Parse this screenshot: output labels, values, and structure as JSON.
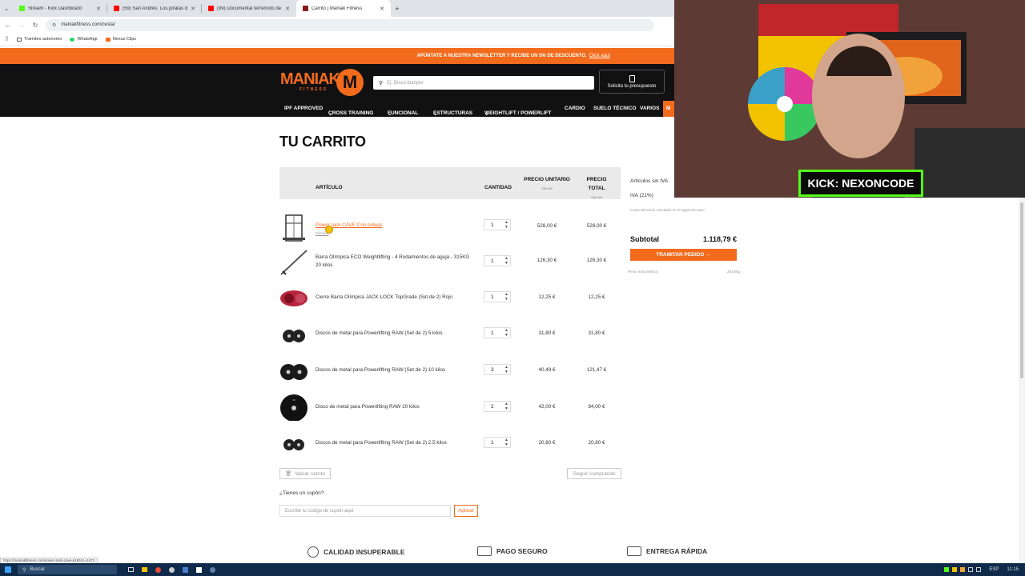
{
  "browser": {
    "tabs": [
      {
        "title": "Stream - Kick Dashboard",
        "color": "#53fc18"
      },
      {
        "title": "(59) San Andrés: Los piratas de",
        "color": "#ff0000"
      },
      {
        "title": "(99) Documental terremoto de",
        "color": "#ff0000"
      },
      {
        "title": "Carrito | Maniak Fitness",
        "color": "#8b1a1a"
      }
    ],
    "url": "maniakfitness.com/cesta/",
    "bookmarks": [
      "Tramites autonomo",
      "WhatsApp",
      "Nexus Clips"
    ]
  },
  "promo": {
    "text": "APÚNTATE A NUESTRA NEWSLETTER Y RECIBE UN 5% DE DESCUENTO.",
    "link": "Click aquí"
  },
  "header": {
    "logo_word": "MANIAK",
    "logo_sub": "FITNESS",
    "logo_letter": "M",
    "search_placeholder": "Ej: Disco bumper",
    "budget_label": "Solicita tu presupuesto"
  },
  "menu": [
    "IPF APPROVED",
    "CROSS TRAINING",
    "FUNCIONAL",
    "ESTRUCTURAS",
    "WEIGHTLIFT / POWERLIFT",
    "CARDIO",
    "SUELO TÉCNICO",
    "VARIOS",
    "M"
  ],
  "cart": {
    "title": "TU CARRITO",
    "headers": {
      "article": "ARTÍCULO",
      "qty": "CANTIDAD",
      "unit": "PRECIO UNITARIO",
      "total": "PRECIO TOTAL",
      "sin_iva": "SIN IVA"
    },
    "rows": [
      {
        "name": "Power rack CAVE Con poleas",
        "remove": "Eliminar",
        "qty": "1",
        "unit": "528,00 €",
        "total": "528,00 €"
      },
      {
        "name": "Barra Olímpica ECO Weightlifting - 4 Rodamientos de aguja - 315KG 20 kilos",
        "qty": "1",
        "unit": "126,30 €",
        "total": "126,30 €"
      },
      {
        "name": "Cierre Barra Olímpica JACK LOCK TopGrade (Set de 2) Rojo",
        "qty": "1",
        "unit": "12,25 €",
        "total": "12,25 €"
      },
      {
        "name": "Discos de metal para Powerlifting RAW (Set de 2) 5 kilos",
        "qty": "1",
        "unit": "31,80 €",
        "total": "31,80 €"
      },
      {
        "name": "Discos de metal para Powerlifting RAW (Set de 2) 10 kilos",
        "qty": "3",
        "unit": "40,49 €",
        "total": "121,47 €"
      },
      {
        "name": "Disco de metal para Powerlifting RAW 20 kilos",
        "qty": "2",
        "unit": "42,00 €",
        "total": "84,00 €"
      },
      {
        "name": "Discos de metal para Powerlifting RAW (Set de 2) 2.5 kilos",
        "qty": "1",
        "unit": "20,80 €",
        "total": "20,80 €"
      }
    ],
    "empty_cart": "Vaciar carrito",
    "continue": "Seguir comprando",
    "coupon_question": "¿Tienes un cupón?",
    "coupon_placeholder": "Escribe tu código de cupón aquí",
    "apply": "Aplicar"
  },
  "summary": {
    "items_no_vat": "Artículos sin IVA",
    "vat": "IVA (21%)",
    "shipping_note": "Coste del envío calculado en el siguiente paso",
    "subtotal_label": "Subtotal",
    "subtotal_value": "1.118,79 €",
    "checkout": "TRAMITAR PEDIDO →",
    "weight_label": "Peso (volumétrico)",
    "weight_value": "253.5kg"
  },
  "features": [
    "CALIDAD INSUPERABLE",
    "PAGO SEGURO",
    "ENTREGA RÁPIDA"
  ],
  "overlay": {
    "badge": "KICK: NEXONCODE"
  },
  "status_url": "https://maniakfitness.com/power-rack-cave-p1851c=4471",
  "taskbar": {
    "search": "Buscar",
    "lang": "ESP",
    "time": "11:15"
  }
}
